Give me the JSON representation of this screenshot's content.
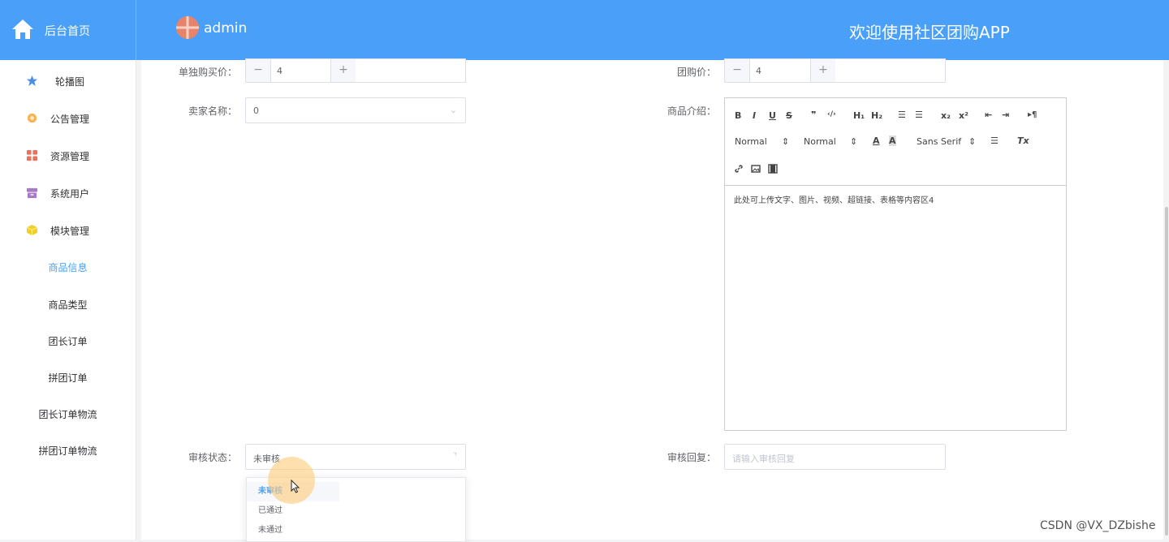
{
  "header": {
    "home_label": "后台首页",
    "user_name": "admin",
    "welcome": "欢迎使用社区团购APP",
    "bg_color": "#4aa0f9"
  },
  "sidebar": {
    "menu": [
      {
        "label": "轮播图",
        "icon": "star-icon",
        "color": "#4a90e2"
      },
      {
        "label": "公告管理",
        "icon": "gear-icon",
        "color": "#f5b555"
      },
      {
        "label": "资源管理",
        "icon": "grid-icon",
        "color": "#e8725f"
      },
      {
        "label": "系统用户",
        "icon": "archive-icon",
        "color": "#a77bc4"
      },
      {
        "label": "模块管理",
        "icon": "cube-icon",
        "color": "#f0d02a"
      }
    ],
    "submenu": [
      {
        "label": "商品信息",
        "active": true
      },
      {
        "label": "商品类型"
      },
      {
        "label": "团长订单"
      },
      {
        "label": "拼团订单"
      },
      {
        "label": "团长订单物流"
      },
      {
        "label": "拼团订单物流"
      }
    ]
  },
  "form": {
    "single_price": {
      "label": "单独购买价：",
      "value": "4",
      "minus": "−",
      "plus": "+"
    },
    "group_price": {
      "label": "团购价：",
      "value": "4",
      "minus": "−",
      "plus": "+"
    },
    "seller": {
      "label": "卖家名称：",
      "value": "0"
    },
    "intro": {
      "label": "商品介绍：",
      "toolbar": {
        "bold": "B",
        "italic": "I",
        "underline": "U",
        "strike": "S",
        "quote": "❞",
        "code": "‹/›",
        "h1": "H₁",
        "h2": "H₂",
        "ol": "☰",
        "ul": "☰",
        "sub": "x₂",
        "sup": "x²",
        "outdent": "⇤",
        "indent": "⇥",
        "direction": "▸¶",
        "size": "Normal",
        "header": "Normal",
        "font": "Sans Serif",
        "color": "A",
        "background": "A",
        "align": "☰",
        "clean": "Tx"
      },
      "content": "此处可上传文字、图片、视频、超链接、表格等内容区4"
    },
    "audit_status": {
      "label": "审核状态：",
      "value": "未审核"
    },
    "audit_reply": {
      "label": "审核回复：",
      "placeholder": "请输入审核回复"
    },
    "dropdown_options": [
      "未审核",
      "已通过",
      "未通过"
    ]
  },
  "watermark": "CSDN @VX_DZbishe"
}
